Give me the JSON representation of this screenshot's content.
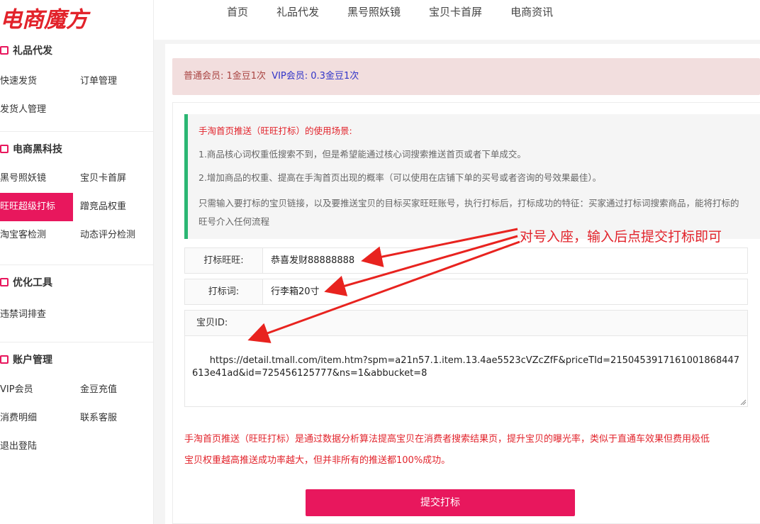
{
  "brand": {
    "logo_text": "电商魔方"
  },
  "nav": [
    "首页",
    "礼品代发",
    "黑号照妖镜",
    "宝贝卡首屏",
    "电商资讯"
  ],
  "sidebar": {
    "groups": [
      {
        "title": "礼品代发",
        "items": [
          "快速发货",
          "订单管理",
          "发货人管理"
        ]
      },
      {
        "title": "电商黑科技",
        "items": [
          "黑号照妖镜",
          "宝贝卡首屏",
          "旺旺超级打标",
          "蹭竞品权重",
          "淘宝客检测",
          "动态评分检测"
        ]
      },
      {
        "title": "优化工具",
        "items": [
          "违禁词排查"
        ]
      },
      {
        "title": "账户管理",
        "items": [
          "VIP会员",
          "金豆充值",
          "消费明细",
          "联系客服",
          "退出登陆"
        ]
      }
    ],
    "active_item": "旺旺超级打标"
  },
  "notice": {
    "normal": "普通会员: 1金豆1次",
    "vip": "VIP会员: 0.3金豆1次"
  },
  "tips": {
    "title": "手淘首页推送（旺旺打标）的使用场景:",
    "lines": [
      "1.商品核心词权重低搜索不到，但是希望能通过核心词搜索推送首页或者下单成交。",
      "2.增加商品的权重、提高在手淘首页出现的概率（可以使用在店铺下单的买号或者咨询的号效果最佳）。",
      "只需输入要打标的宝贝链接，以及要推送宝贝的目标买家旺旺账号，执行打标后，打标成功的特征：买家通过打标词搜索商品，能将打标的",
      "旺号介入任何流程"
    ]
  },
  "form": {
    "wangwang_label": "打标旺旺:",
    "wangwang_value": "恭喜发财88888888",
    "keyword_label": "打标词:",
    "keyword_value": "行李箱20寸",
    "id_label": "宝贝ID:",
    "id_value": "https://detail.tmall.com/item.htm?spm=a21n57.1.item.13.4ae5523cVZcZfF&priceTId=2150453917161001868447613e41ad&id=725456125777&ns=1&abbucket=8"
  },
  "description": [
    "手淘首页推送（旺旺打标）是通过数据分析算法提高宝贝在消费者搜索结果页，提升宝贝的曝光率，类似于直通车效果但费用极低",
    "宝贝权重越高推送成功率越大，但并非所有的推送都100%成功。"
  ],
  "submit_label": "提交打标",
  "annotation": "对号入座，输入后点提交打标即可",
  "colors": {
    "accent": "#e8175d",
    "brand_red": "#e2232b",
    "tip_border": "#2bb673",
    "notice_bg": "#f2dede"
  }
}
